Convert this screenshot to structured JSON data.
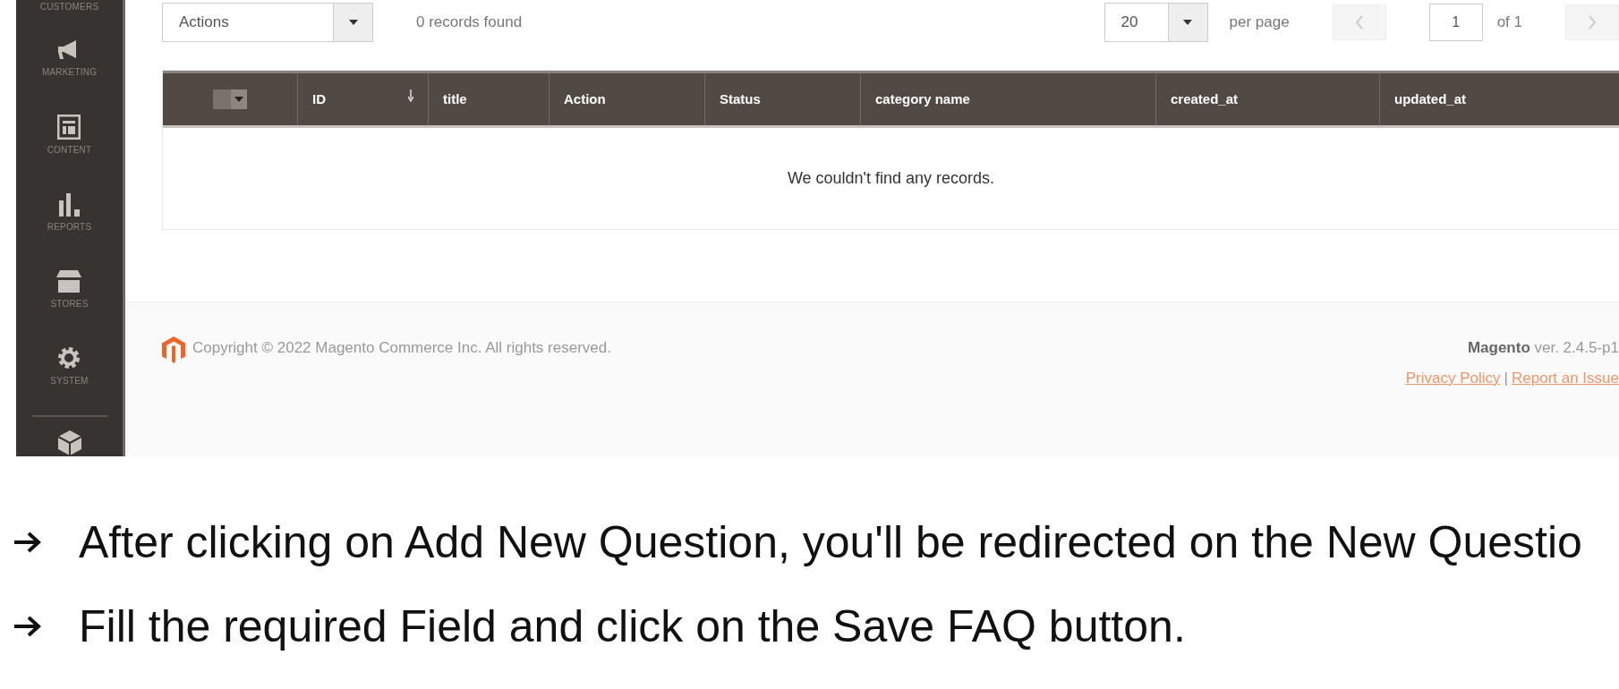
{
  "sidebar": {
    "items": [
      {
        "label": "CUSTOMERS"
      },
      {
        "label": "MARKETING"
      },
      {
        "label": "CONTENT"
      },
      {
        "label": "REPORTS"
      },
      {
        "label": "STORES"
      },
      {
        "label": "SYSTEM"
      }
    ]
  },
  "toolbar": {
    "actions_select": {
      "value": "Actions"
    },
    "records_found": "0 records found",
    "per_page": {
      "value": "20"
    },
    "per_page_label": "per page",
    "prev_disabled": true,
    "page_input": {
      "value": "1"
    },
    "page_total": "of 1",
    "next_disabled": true
  },
  "table": {
    "columns": [
      {
        "kind": "select"
      },
      {
        "kind": "text",
        "label": "ID",
        "sorted": true
      },
      {
        "kind": "text",
        "label": "title",
        "sorted": false
      },
      {
        "kind": "text",
        "label": "Action",
        "sorted": false
      },
      {
        "kind": "text",
        "label": "Status",
        "sorted": false
      },
      {
        "kind": "text",
        "label": "category name",
        "sorted": false
      },
      {
        "kind": "text",
        "label": "created_at",
        "sorted": false
      },
      {
        "kind": "text",
        "label": "updated_at",
        "sorted": false
      }
    ],
    "empty_message": "We couldn't find any records."
  },
  "footer": {
    "copyright": "Copyright © 2022 Magento Commerce Inc. All rights reserved.",
    "brand": "Magento",
    "version": "ver. 2.4.5-p1",
    "links": [
      "Privacy Policy",
      "Report an Issue"
    ],
    "separator": "|"
  },
  "instructions": [
    "After clicking on Add New Question, you'll be redirected on the New Questio",
    "Fill the required Field and click on the Save FAQ button."
  ]
}
